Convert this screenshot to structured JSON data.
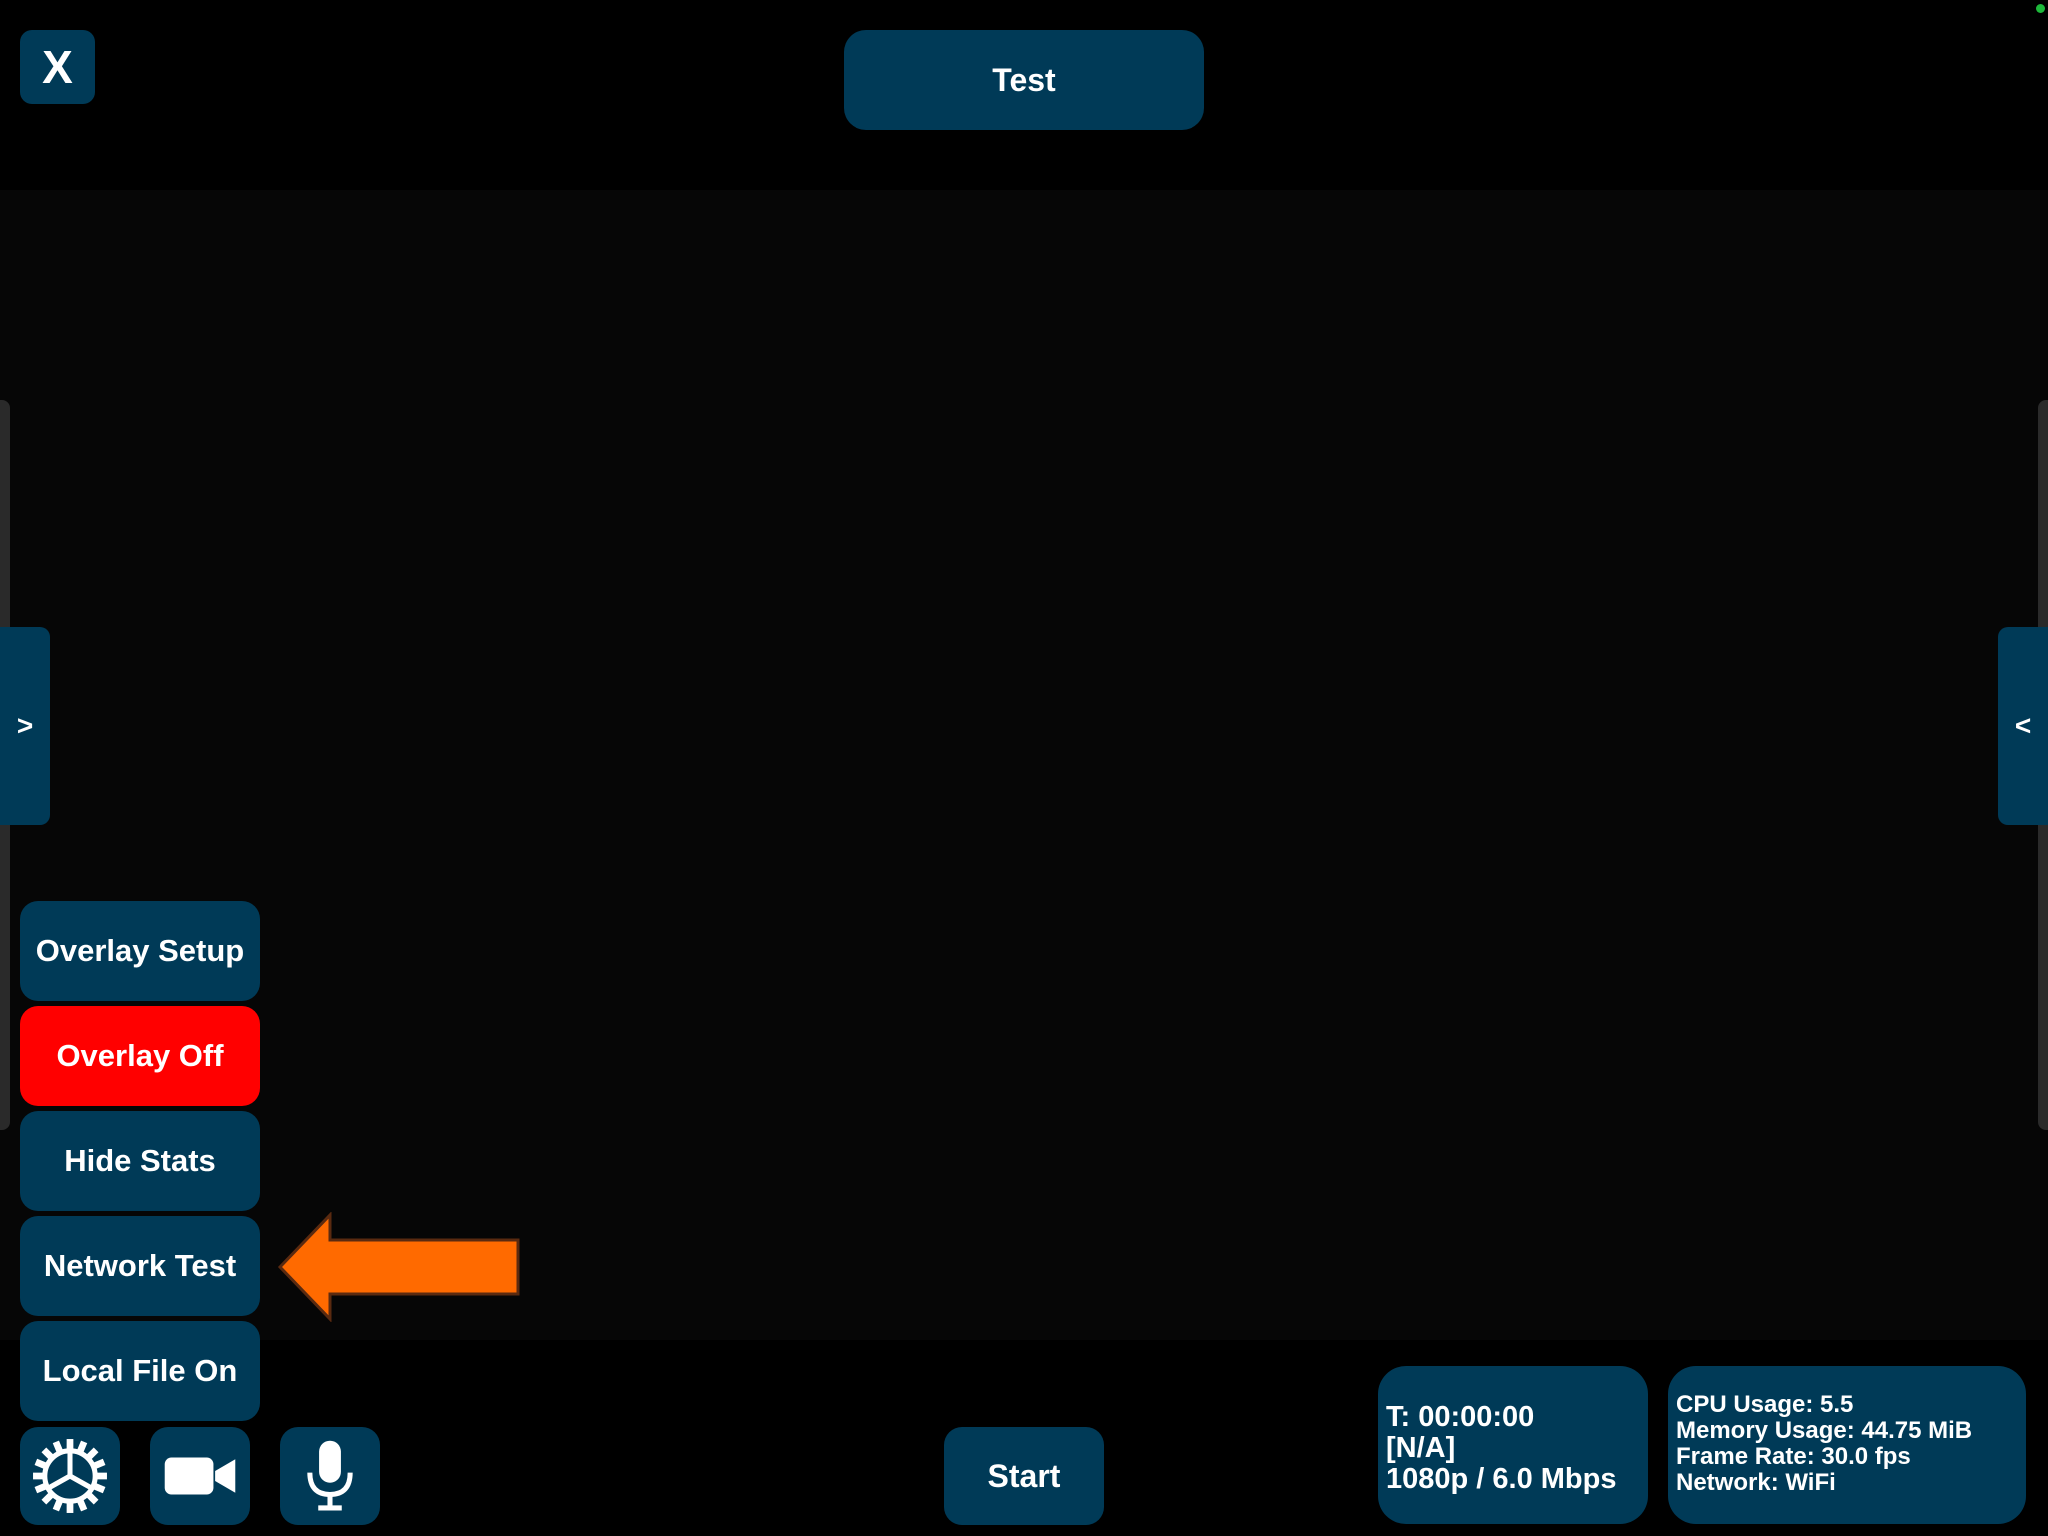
{
  "header": {
    "close_label": "X",
    "title": "Test"
  },
  "side_handles": {
    "left_label": ">",
    "right_label": "<"
  },
  "menu": {
    "items": [
      {
        "label": "Overlay Setup"
      },
      {
        "label": "Overlay Off"
      },
      {
        "label": "Hide Stats"
      },
      {
        "label": "Network Test"
      },
      {
        "label": "Local File On"
      }
    ]
  },
  "toolbar": {
    "icons": [
      "gear-icon",
      "video-camera-icon",
      "microphone-icon"
    ],
    "start_label": "Start"
  },
  "stats": {
    "time": "T: 00:00:00",
    "status": "[N/A]",
    "resolution": "1080p / 6.0 Mbps",
    "cpu": "CPU Usage: 5.5",
    "memory": "Memory Usage: 44.75 MiB",
    "frame_rate": "Frame Rate: 30.0 fps",
    "network": "Network: WiFi"
  },
  "colors": {
    "button_bg": "#003a57",
    "overlay_off_bg": "#ff0000",
    "arrow": "#ff6a00",
    "status_dot": "#1db83a"
  }
}
